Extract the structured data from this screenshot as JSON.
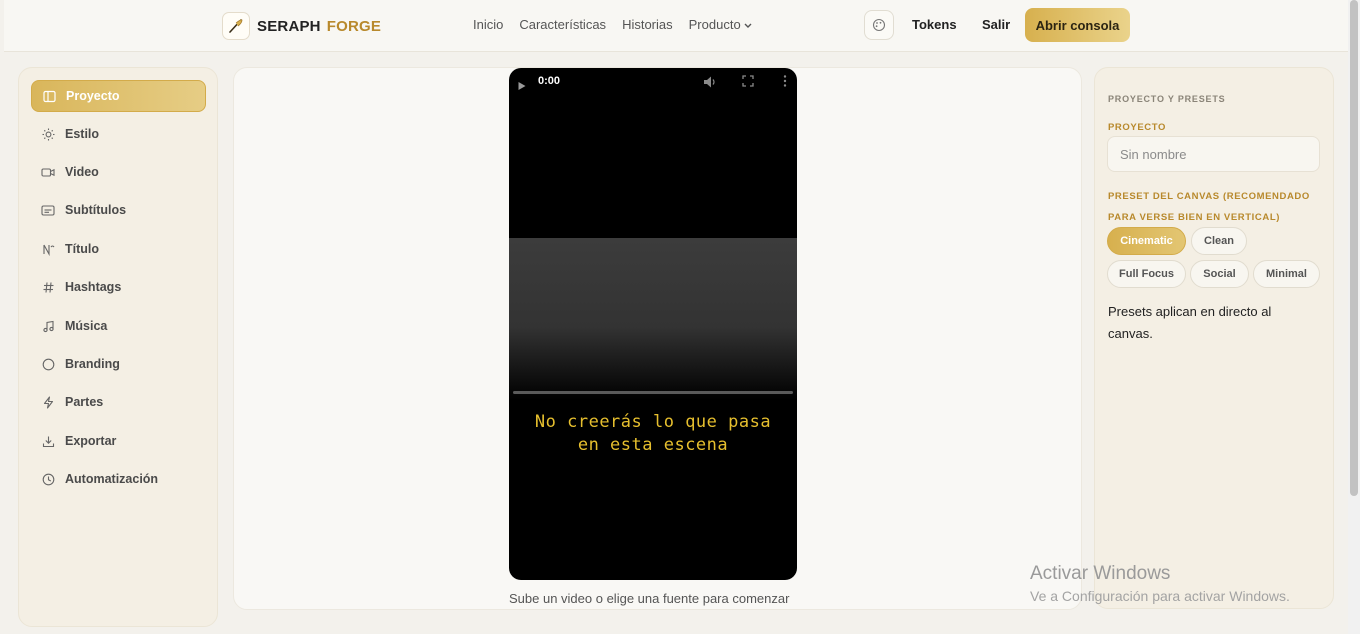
{
  "header": {
    "brand_word1": "SERAPH",
    "brand_word2": "FORGE",
    "nav": [
      "Inicio",
      "Características",
      "Historias",
      "Producto"
    ],
    "tokens_label": "Tokens",
    "logout_label": "Salir",
    "console_label": "Abrir consola"
  },
  "sidebar": {
    "items": [
      {
        "label": "Proyecto",
        "icon": "panel-icon"
      },
      {
        "label": "Estilo",
        "icon": "sun-icon"
      },
      {
        "label": "Video",
        "icon": "video-icon"
      },
      {
        "label": "Subtítulos",
        "icon": "subtitles-icon"
      },
      {
        "label": "Título",
        "icon": "title-icon"
      },
      {
        "label": "Hashtags",
        "icon": "hash-icon"
      },
      {
        "label": "Música",
        "icon": "music-icon"
      },
      {
        "label": "Branding",
        "icon": "circle-icon"
      },
      {
        "label": "Partes",
        "icon": "bolt-icon"
      },
      {
        "label": "Exportar",
        "icon": "download-icon"
      },
      {
        "label": "Automatización",
        "icon": "clock-icon"
      }
    ]
  },
  "player": {
    "time": "0:00",
    "subtitle": "No creerás lo que pasa en esta escena",
    "caption": "Sube un video o elige una fuente para comenzar"
  },
  "right_panel": {
    "heading": "PROYECTO Y PRESETS",
    "project_label": "PROYECTO",
    "project_placeholder": "Sin nombre",
    "preset_label": "PRESET DEL CANVAS (RECOMENDADO PARA VERSE BIEN EN VERTICAL)",
    "presets": [
      "Cinematic",
      "Clean",
      "Full Focus",
      "Social",
      "Minimal"
    ],
    "active_preset": "Cinematic",
    "note": "Presets aplican en directo al canvas."
  },
  "watermark": {
    "line1": "Activar Windows",
    "line2": "Ve a Configuración para activar Windows."
  },
  "colors": {
    "accent": "#d7b04e",
    "brand_gold": "#b8892c",
    "subtitle_gold": "#e6bf2e"
  }
}
